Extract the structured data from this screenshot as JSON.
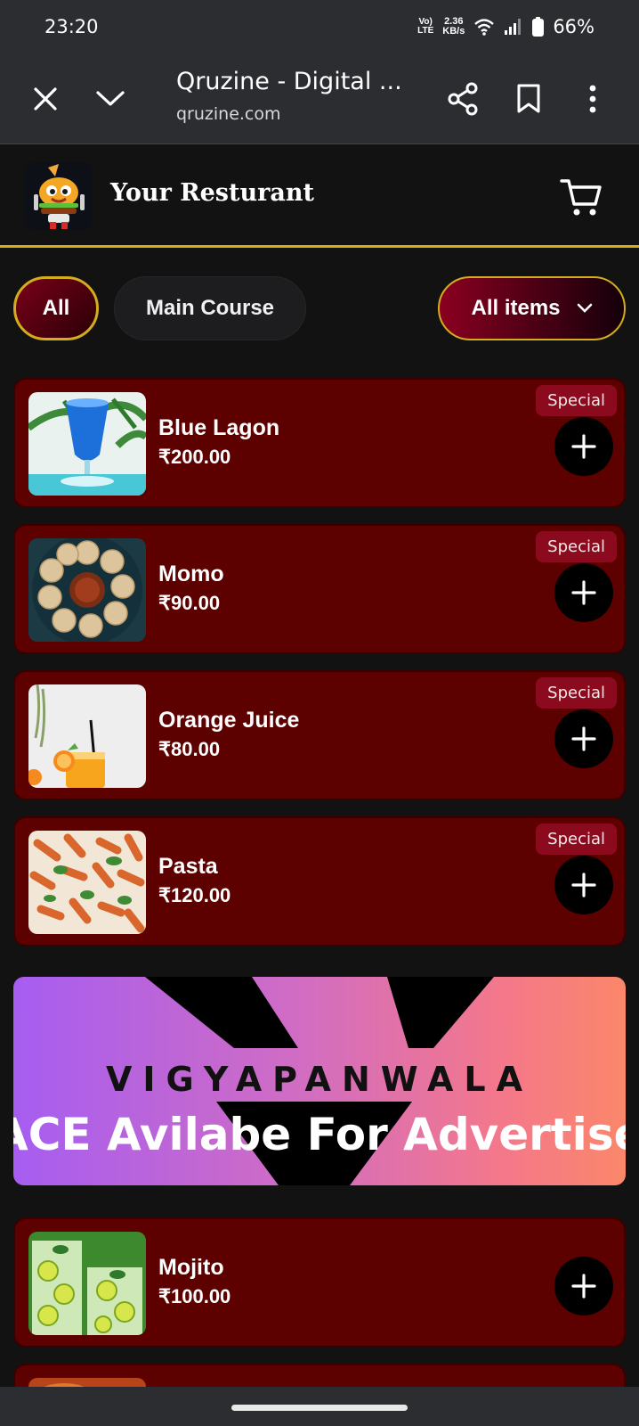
{
  "status_bar": {
    "time": "23:20",
    "network_type": "VoLTE",
    "net_speed_value": "2.36",
    "net_speed_unit": "KB/s",
    "battery": "66%"
  },
  "browser": {
    "title": "Qruzine - Digital ...",
    "url": "qruzine.com"
  },
  "header": {
    "restaurant_name": "Your Resturant"
  },
  "filters": {
    "all_label": "All",
    "main_course_label": "Main Course",
    "dropdown_label": "All items"
  },
  "menu_items": [
    {
      "name": "Blue Lagon",
      "price": "₹200.00",
      "badge": "Special"
    },
    {
      "name": "Momo",
      "price": "₹90.00",
      "badge": "Special"
    },
    {
      "name": "Orange Juice",
      "price": "₹80.00",
      "badge": "Special"
    },
    {
      "name": "Pasta",
      "price": "₹120.00",
      "badge": "Special"
    },
    {
      "name": "Mojito",
      "price": "₹100.00",
      "badge": ""
    }
  ],
  "ad": {
    "brand": "VIGYAPANWALA",
    "tagline": "ACE Avilabe For Advertisem"
  },
  "colors": {
    "accent_gold": "#d4ac1d",
    "card_bg": "#5c0000",
    "badge_bg": "#8c0a1e"
  }
}
